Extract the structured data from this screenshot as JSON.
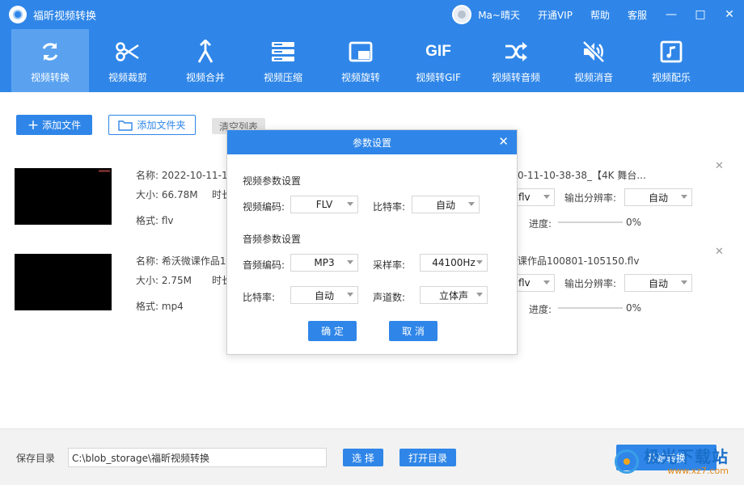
{
  "app": {
    "title": "福昕视频转换"
  },
  "user": {
    "name": "Ma~晴天"
  },
  "title_links": [
    "开通VIP",
    "帮助",
    "客服"
  ],
  "window_controls": {
    "minimize": "—",
    "maximize": "□",
    "close": "✕"
  },
  "toolbar": [
    {
      "label": "视频转换",
      "icon": "refresh-icon",
      "active": true
    },
    {
      "label": "视频裁剪",
      "icon": "scissors-icon"
    },
    {
      "label": "视频合并",
      "icon": "merge-icon"
    },
    {
      "label": "视频压缩",
      "icon": "compress-icon"
    },
    {
      "label": "视频旋转",
      "icon": "rotate-icon"
    },
    {
      "label": "视频转GIF",
      "icon": "gif-icon",
      "icon_text": "GIF"
    },
    {
      "label": "视频转音频",
      "icon": "shuffle-icon"
    },
    {
      "label": "视频消音",
      "icon": "mute-icon"
    },
    {
      "label": "视频配乐",
      "icon": "music-icon"
    }
  ],
  "actions": {
    "add_file": "添加文件",
    "add_folder": "添加文件夹",
    "clear_list": "清空列表"
  },
  "files": [
    {
      "name_label": "名称:",
      "name": "2022-10-11-1",
      "size_label": "大小:",
      "size": "66.78M",
      "duration_label": "时长",
      "format_label": "格式:",
      "format": "flv",
      "output_name": "0-11-10-38-38_【4K 舞台...",
      "output_format": "flv",
      "resolution_label": "输出分辨率:",
      "resolution": "自动",
      "progress_label": "进度:",
      "progress": "0%"
    },
    {
      "name_label": "名称:",
      "name": "希沃微课作品1",
      "size_label": "大小:",
      "size": "2.75M",
      "duration_label": "时长",
      "format_label": "格式:",
      "format": "mp4",
      "output_name": "课作品100801-105150.flv",
      "output_format": "flv",
      "resolution_label": "输出分辨率:",
      "resolution": "自动",
      "progress_label": "进度:",
      "progress": "0%"
    }
  ],
  "bottom": {
    "save_label": "保存目录",
    "path": "C:\\blob_storage\\福昕视频转换",
    "choose": "选 择",
    "open_dir": "打开目录",
    "start": "开始转换"
  },
  "watermark": {
    "big": "极光下载站",
    "small": "www.xz7.com"
  },
  "modal": {
    "title": "参数设置",
    "close": "✕",
    "video_section": "视频参数设置",
    "video_codec_label": "视频编码:",
    "video_codec": "FLV",
    "video_bitrate_label": "比特率:",
    "video_bitrate": "自动",
    "audio_section": "音频参数设置",
    "audio_codec_label": "音频编码:",
    "audio_codec": "MP3",
    "sample_rate_label": "采样率:",
    "sample_rate": "44100Hz",
    "audio_bitrate_label": "比特率:",
    "audio_bitrate": "自动",
    "channels_label": "声道数:",
    "channels": "立体声",
    "ok": "确 定",
    "cancel": "取 消"
  }
}
